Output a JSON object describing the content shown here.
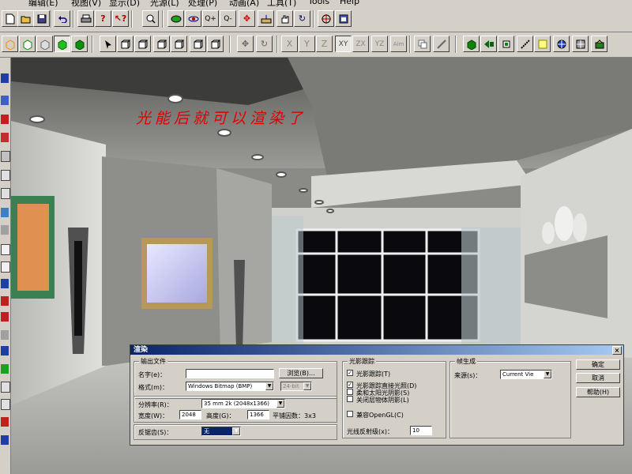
{
  "menu": [
    "编辑(E)",
    "视图(V)",
    "显示(D)",
    "光源(L)",
    "处理(P)",
    "动画(A)",
    "工具(T)",
    "Tools",
    "Help"
  ],
  "toolbar2": {
    "axes": [
      "X",
      "Y",
      "Z",
      "XY",
      "ZX",
      "YZ",
      "Aim"
    ]
  },
  "viewport": {
    "caption": "光能后就可以渲染了"
  },
  "dialog": {
    "title": "渲染",
    "close": "×",
    "output": {
      "group_label": "输出文件",
      "name_label": "名字(e)：",
      "name_value": "",
      "browse": "浏览(B)...",
      "format_label": "格式(m)：",
      "format_value": "Windows Bitmap (BMP)",
      "bits_value": "24-bit"
    },
    "resolution": {
      "label": "分辨率(R)：",
      "value": "35 mm 2k (2048x1366)",
      "width_label": "宽度(W)：",
      "width_value": "2048",
      "height_label": "高度(G)：",
      "height_value": "1366",
      "aa_text": "平铺因数：3x3"
    },
    "antialias": {
      "label": "反锯齿(S)：",
      "value": "无"
    },
    "raytrace": {
      "group_label": "光影跟踪",
      "opt1": "光影跟踪(T)",
      "opt2": "光影跟踪直接光照(D)",
      "opt3": "柔和太阳光阴影(S)",
      "opt4": "关闭层物体阴影(L)",
      "opt5": "兼容OpenGL(C)",
      "reflect_label": "光线反射级(x)：",
      "reflect_value": "10"
    },
    "frames": {
      "group_label": "帧生成",
      "source_label": "来源(s)：",
      "source_value": "Current Vie"
    },
    "buttons": {
      "ok": "确定",
      "cancel": "取消",
      "help": "帮助(H)"
    }
  }
}
